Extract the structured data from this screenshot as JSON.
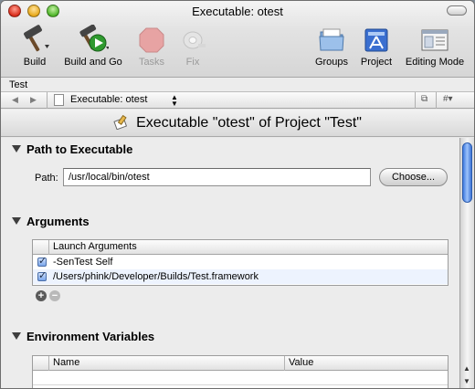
{
  "window": {
    "title": "Executable: otest"
  },
  "toolbar": {
    "items": [
      {
        "label": "Build",
        "icon": "hammer-icon",
        "enabled": true
      },
      {
        "label": "Build and Go",
        "icon": "build-and-go-icon",
        "enabled": true
      },
      {
        "label": "Tasks",
        "icon": "stop-sign-icon",
        "enabled": false
      },
      {
        "label": "Fix",
        "icon": "bandage-icon",
        "enabled": false
      },
      {
        "label": "Groups",
        "icon": "folder-icon",
        "enabled": true
      },
      {
        "label": "Project",
        "icon": "app-icon",
        "enabled": true
      },
      {
        "label": "Editing Mode",
        "icon": "editing-mode-icon",
        "enabled": true
      }
    ]
  },
  "breadcrumb": "Test",
  "navbar": {
    "file_label": "Executable: otest",
    "right1": "⧉",
    "right2": "#▾"
  },
  "header": {
    "title": "Executable \"otest\" of Project \"Test\""
  },
  "path_section": {
    "title": "Path to Executable",
    "label": "Path:",
    "value": "/usr/local/bin/otest",
    "button": "Choose..."
  },
  "arguments_section": {
    "title": "Arguments",
    "column": "Launch Arguments",
    "rows": [
      {
        "checked": true,
        "text": "-SenTest Self"
      },
      {
        "checked": true,
        "text": "/Users/phink/Developer/Builds/Test.framework"
      }
    ]
  },
  "env_section": {
    "title": "Environment Variables",
    "columns": [
      "Name",
      "Value"
    ]
  },
  "colors": {
    "accent": "#3f7be0",
    "row_alt": "#edf3fe"
  }
}
